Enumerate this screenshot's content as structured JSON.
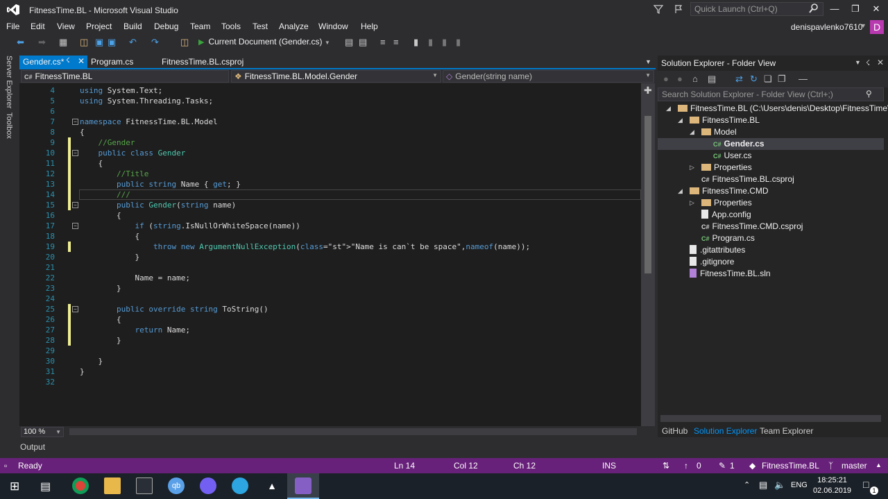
{
  "window": {
    "title": "FitnessTime.BL - Microsoft Visual Studio",
    "quick_launch_placeholder": "Quick Launch (Ctrl+Q)",
    "user": "denispavlenko7610",
    "avatar_letter": "D"
  },
  "menu": [
    "File",
    "Edit",
    "View",
    "Project",
    "Build",
    "Debug",
    "Team",
    "Tools",
    "Test",
    "Analyze",
    "Window",
    "Help"
  ],
  "toolbar": {
    "run_label": "Current Document (Gender.cs)"
  },
  "left_rail": [
    "Server Explorer",
    "Toolbox"
  ],
  "editor_tabs": [
    {
      "label": "Gender.cs*",
      "active": true
    },
    {
      "label": "Program.cs",
      "active": false
    },
    {
      "label": "FitnessTime.BL.csproj",
      "active": false
    }
  ],
  "navbar": {
    "project": "FitnessTime.BL",
    "type": "FitnessTime.BL.Model.Gender",
    "member": "Gender(string name)"
  },
  "code_lines": [
    {
      "n": "4",
      "t": "using System.Text;"
    },
    {
      "n": "5",
      "t": "using System.Threading.Tasks;"
    },
    {
      "n": "6",
      "t": ""
    },
    {
      "n": "7",
      "t": "namespace FitnessTime.BL.Model"
    },
    {
      "n": "8",
      "t": "{"
    },
    {
      "n": "9",
      "t": "    //Gender"
    },
    {
      "n": "10",
      "t": "    public class Gender"
    },
    {
      "n": "11",
      "t": "    {"
    },
    {
      "n": "12",
      "t": "        //Title"
    },
    {
      "n": "13",
      "t": "        public string Name { get; }"
    },
    {
      "n": "14",
      "t": "        ///"
    },
    {
      "n": "15",
      "t": "        public Gender(string name)"
    },
    {
      "n": "16",
      "t": "        {"
    },
    {
      "n": "17",
      "t": "            if (string.IsNullOrWhiteSpace(name))"
    },
    {
      "n": "18",
      "t": "            {"
    },
    {
      "n": "19",
      "t": "                throw new ArgumentNullException(\"Name is can`t be space\",nameof(name));"
    },
    {
      "n": "20",
      "t": "            }"
    },
    {
      "n": "21",
      "t": ""
    },
    {
      "n": "22",
      "t": "            Name = name;"
    },
    {
      "n": "23",
      "t": "        }"
    },
    {
      "n": "24",
      "t": ""
    },
    {
      "n": "25",
      "t": "        public override string ToString()"
    },
    {
      "n": "26",
      "t": "        {"
    },
    {
      "n": "27",
      "t": "            return Name;"
    },
    {
      "n": "28",
      "t": "        }"
    },
    {
      "n": "29",
      "t": ""
    },
    {
      "n": "30",
      "t": "    }"
    },
    {
      "n": "31",
      "t": "}"
    },
    {
      "n": "32",
      "t": ""
    }
  ],
  "zoom": "100 %",
  "output_tab": "Output",
  "solution_explorer": {
    "title": "Solution Explorer - Folder View",
    "search_placeholder": "Search Solution Explorer - Folder View (Ctrl+;)",
    "tree": [
      {
        "label": "FitnessTime.BL (C:\\Users\\denis\\Desktop\\FitnessTime\\Fit",
        "kind": "folder"
      },
      {
        "label": "FitnessTime.BL",
        "kind": "folder"
      },
      {
        "label": "Model",
        "kind": "folder"
      },
      {
        "label": "Gender.cs",
        "kind": "cs"
      },
      {
        "label": "User.cs",
        "kind": "cs"
      },
      {
        "label": "Properties",
        "kind": "folder"
      },
      {
        "label": "FitnessTime.BL.csproj",
        "kind": "proj"
      },
      {
        "label": "FitnessTime.CMD",
        "kind": "folder"
      },
      {
        "label": "Properties",
        "kind": "folder"
      },
      {
        "label": "App.config",
        "kind": "doc"
      },
      {
        "label": "FitnessTime.CMD.csproj",
        "kind": "proj"
      },
      {
        "label": "Program.cs",
        "kind": "cs"
      },
      {
        "label": ".gitattributes",
        "kind": "doc"
      },
      {
        "label": ".gitignore",
        "kind": "doc"
      },
      {
        "label": "FitnessTime.BL.sln",
        "kind": "sln"
      }
    ],
    "tabs": [
      "GitHub",
      "Solution Explorer",
      "Team Explorer"
    ]
  },
  "status": {
    "ready": "Ready",
    "ln": "Ln 14",
    "col": "Col 12",
    "ch": "Ch 12",
    "ins": "INS",
    "up": "0",
    "pencil": "1",
    "repo": "FitnessTime.BL",
    "branch": "master"
  },
  "taskbar": {
    "lang": "ENG",
    "time": "18:25:21",
    "date": "02.06.2019",
    "notif": "1"
  },
  "colors": {
    "accent": "#007acc",
    "status_bar": "#68217a",
    "keyword": "#569cd6",
    "type": "#4ec9b0",
    "comment": "#57a64a",
    "string": "#d69d85"
  }
}
